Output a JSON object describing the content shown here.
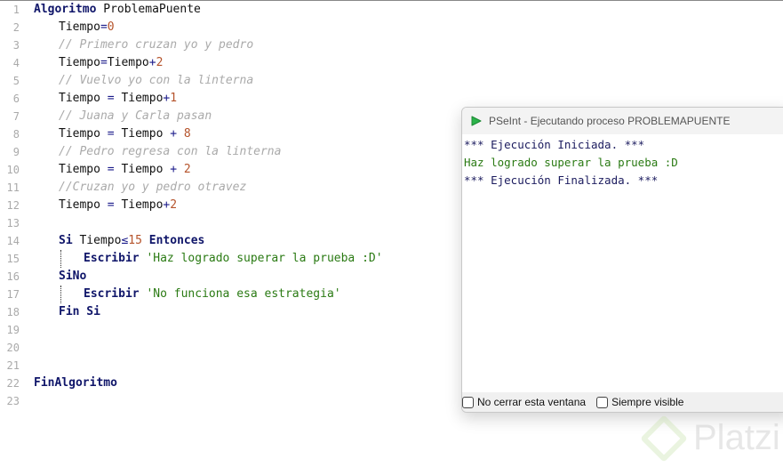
{
  "editor": {
    "lines": [
      {
        "n": "1",
        "indent": 0,
        "tokens": [
          [
            "kw",
            "Algoritmo"
          ],
          [
            "id",
            " ProblemaPuente"
          ]
        ]
      },
      {
        "n": "2",
        "indent": 1,
        "tokens": [
          [
            "id",
            "Tiempo"
          ],
          [
            "op",
            "="
          ],
          [
            "num",
            "0"
          ]
        ]
      },
      {
        "n": "3",
        "indent": 1,
        "tokens": [
          [
            "cm",
            "// Primero cruzan yo y pedro"
          ]
        ]
      },
      {
        "n": "4",
        "indent": 1,
        "tokens": [
          [
            "id",
            "Tiempo"
          ],
          [
            "op",
            "="
          ],
          [
            "id",
            "Tiempo"
          ],
          [
            "op",
            "+"
          ],
          [
            "num",
            "2"
          ]
        ]
      },
      {
        "n": "5",
        "indent": 1,
        "tokens": [
          [
            "cm",
            "// Vuelvo yo con la linterna"
          ]
        ]
      },
      {
        "n": "6",
        "indent": 1,
        "tokens": [
          [
            "id",
            "Tiempo "
          ],
          [
            "op",
            "="
          ],
          [
            "id",
            " Tiempo"
          ],
          [
            "op",
            "+"
          ],
          [
            "num",
            "1"
          ]
        ]
      },
      {
        "n": "7",
        "indent": 1,
        "tokens": [
          [
            "cm",
            "// Juana y Carla pasan"
          ]
        ]
      },
      {
        "n": "8",
        "indent": 1,
        "tokens": [
          [
            "id",
            "Tiempo "
          ],
          [
            "op",
            "="
          ],
          [
            "id",
            " Tiempo "
          ],
          [
            "op",
            "+"
          ],
          [
            "num",
            " 8"
          ]
        ]
      },
      {
        "n": "9",
        "indent": 1,
        "tokens": [
          [
            "cm",
            "// Pedro regresa con la linterna"
          ]
        ]
      },
      {
        "n": "10",
        "indent": 1,
        "tokens": [
          [
            "id",
            "Tiempo "
          ],
          [
            "op",
            "="
          ],
          [
            "id",
            " Tiempo "
          ],
          [
            "op",
            "+"
          ],
          [
            "num",
            " 2"
          ]
        ]
      },
      {
        "n": "11",
        "indent": 1,
        "tokens": [
          [
            "cm",
            "//Cruzan yo y pedro otravez"
          ]
        ]
      },
      {
        "n": "12",
        "indent": 1,
        "tokens": [
          [
            "id",
            "Tiempo "
          ],
          [
            "op",
            "="
          ],
          [
            "id",
            " Tiempo"
          ],
          [
            "op",
            "+"
          ],
          [
            "num",
            "2"
          ]
        ]
      },
      {
        "n": "13",
        "indent": 0,
        "tokens": []
      },
      {
        "n": "14",
        "indent": 1,
        "tokens": [
          [
            "kw",
            "Si"
          ],
          [
            "id",
            " Tiempo"
          ],
          [
            "op",
            "≤"
          ],
          [
            "num",
            "15"
          ],
          [
            "kw",
            " Entonces"
          ]
        ]
      },
      {
        "n": "15",
        "indent": 2,
        "guide": true,
        "tokens": [
          [
            "kw",
            "Escribir"
          ],
          [
            "str",
            " 'Haz logrado superar la prueba :D'"
          ]
        ]
      },
      {
        "n": "16",
        "indent": 1,
        "tokens": [
          [
            "kw",
            "SiNo"
          ]
        ]
      },
      {
        "n": "17",
        "indent": 2,
        "guide": true,
        "tokens": [
          [
            "kw",
            "Escribir"
          ],
          [
            "str",
            " 'No funciona esa estrategia'"
          ]
        ]
      },
      {
        "n": "18",
        "indent": 1,
        "tokens": [
          [
            "kw",
            "Fin Si"
          ]
        ]
      },
      {
        "n": "19",
        "indent": 0,
        "tokens": []
      },
      {
        "n": "20",
        "indent": 0,
        "tokens": []
      },
      {
        "n": "21",
        "indent": 0,
        "tokens": []
      },
      {
        "n": "22",
        "indent": 0,
        "tokens": [
          [
            "kw",
            "FinAlgoritmo"
          ]
        ]
      },
      {
        "n": "23",
        "indent": 0,
        "tokens": []
      }
    ]
  },
  "run_window": {
    "title": "PSeInt - Ejecutando proceso PROBLEMAPUENTE",
    "output": [
      {
        "cls": "o1",
        "text": "*** Ejecución Iniciada. ***"
      },
      {
        "cls": "o2",
        "text": "Haz logrado superar la prueba :D"
      },
      {
        "cls": "o1",
        "text": "*** Ejecución Finalizada. ***"
      }
    ],
    "keep_open_label": "No cerrar esta ventana",
    "always_visible_label": "Siempre visible"
  },
  "watermark": "Platzi"
}
